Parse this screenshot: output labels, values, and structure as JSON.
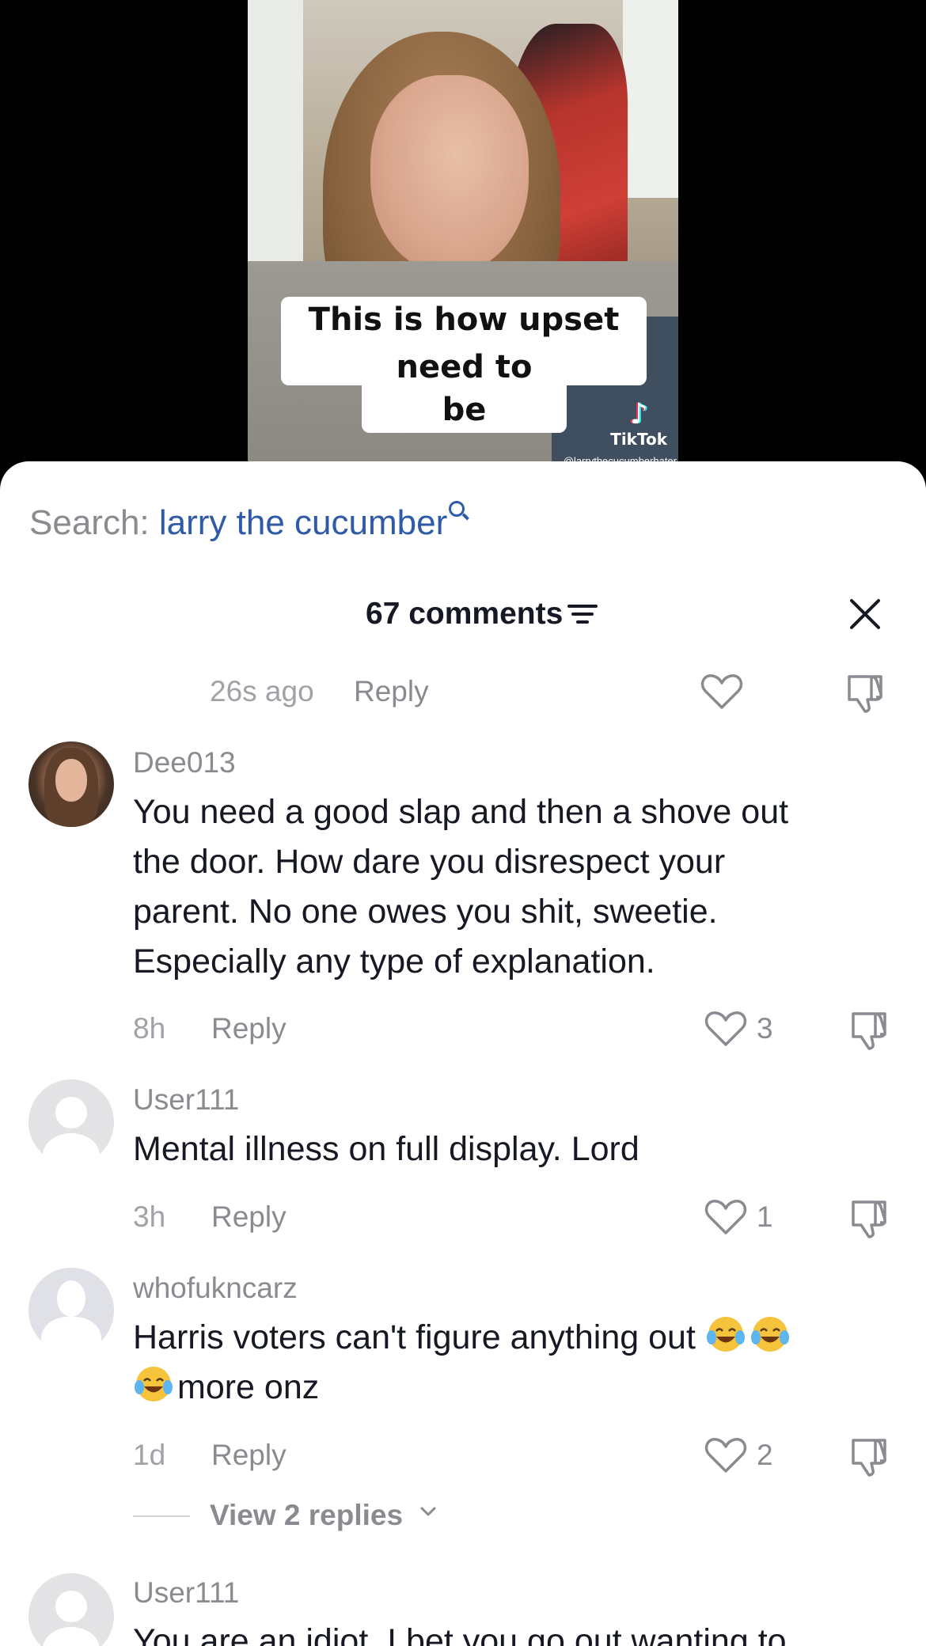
{
  "video": {
    "caption_line1": "This is how upset we",
    "caption_line2": "need to be",
    "watermark": "TikTok",
    "watermark_user": "@larrythecucumberhater"
  },
  "search": {
    "label": "Search: ",
    "term": "larry the cucumber",
    "icon": "search-icon",
    "color": "#2e5aa6"
  },
  "header": {
    "title": "67 comments",
    "filter_icon": "filter-icon",
    "close_icon": "close-icon"
  },
  "partial_comment": {
    "time": "26s ago",
    "reply_label": "Reply"
  },
  "comments": [
    {
      "username": "Dee013",
      "text_lines": [
        "You need a good slap and then a shove out",
        "the door. How dare you disrespect your",
        "parent. No one owes you shit, sweetie.",
        "Especially any type of explanation."
      ],
      "time": "8h",
      "reply_label": "Reply",
      "likes": "3",
      "avatar": "photo"
    },
    {
      "username": "User111",
      "text_lines": [
        "Mental illness on full display. Lord"
      ],
      "time": "3h",
      "reply_label": "Reply",
      "likes": "1",
      "avatar": "default"
    },
    {
      "username": "whofukncarz",
      "text_line1": "Harris voters can't figure anything out",
      "text_line2": "more onz",
      "emoji": "face-with-tears-of-joy",
      "time": "1d",
      "reply_label": "Reply",
      "likes": "2",
      "avatar": "silhouette",
      "view_replies": "View 2 replies"
    },
    {
      "username": "User111",
      "text_lines": [
        "You are an idiot. I bet you go out wanting to"
      ],
      "avatar": "default"
    }
  ],
  "colors": {
    "text_primary": "#161823",
    "text_secondary": "#8a8b91",
    "link_blue": "#2e5aa6"
  }
}
